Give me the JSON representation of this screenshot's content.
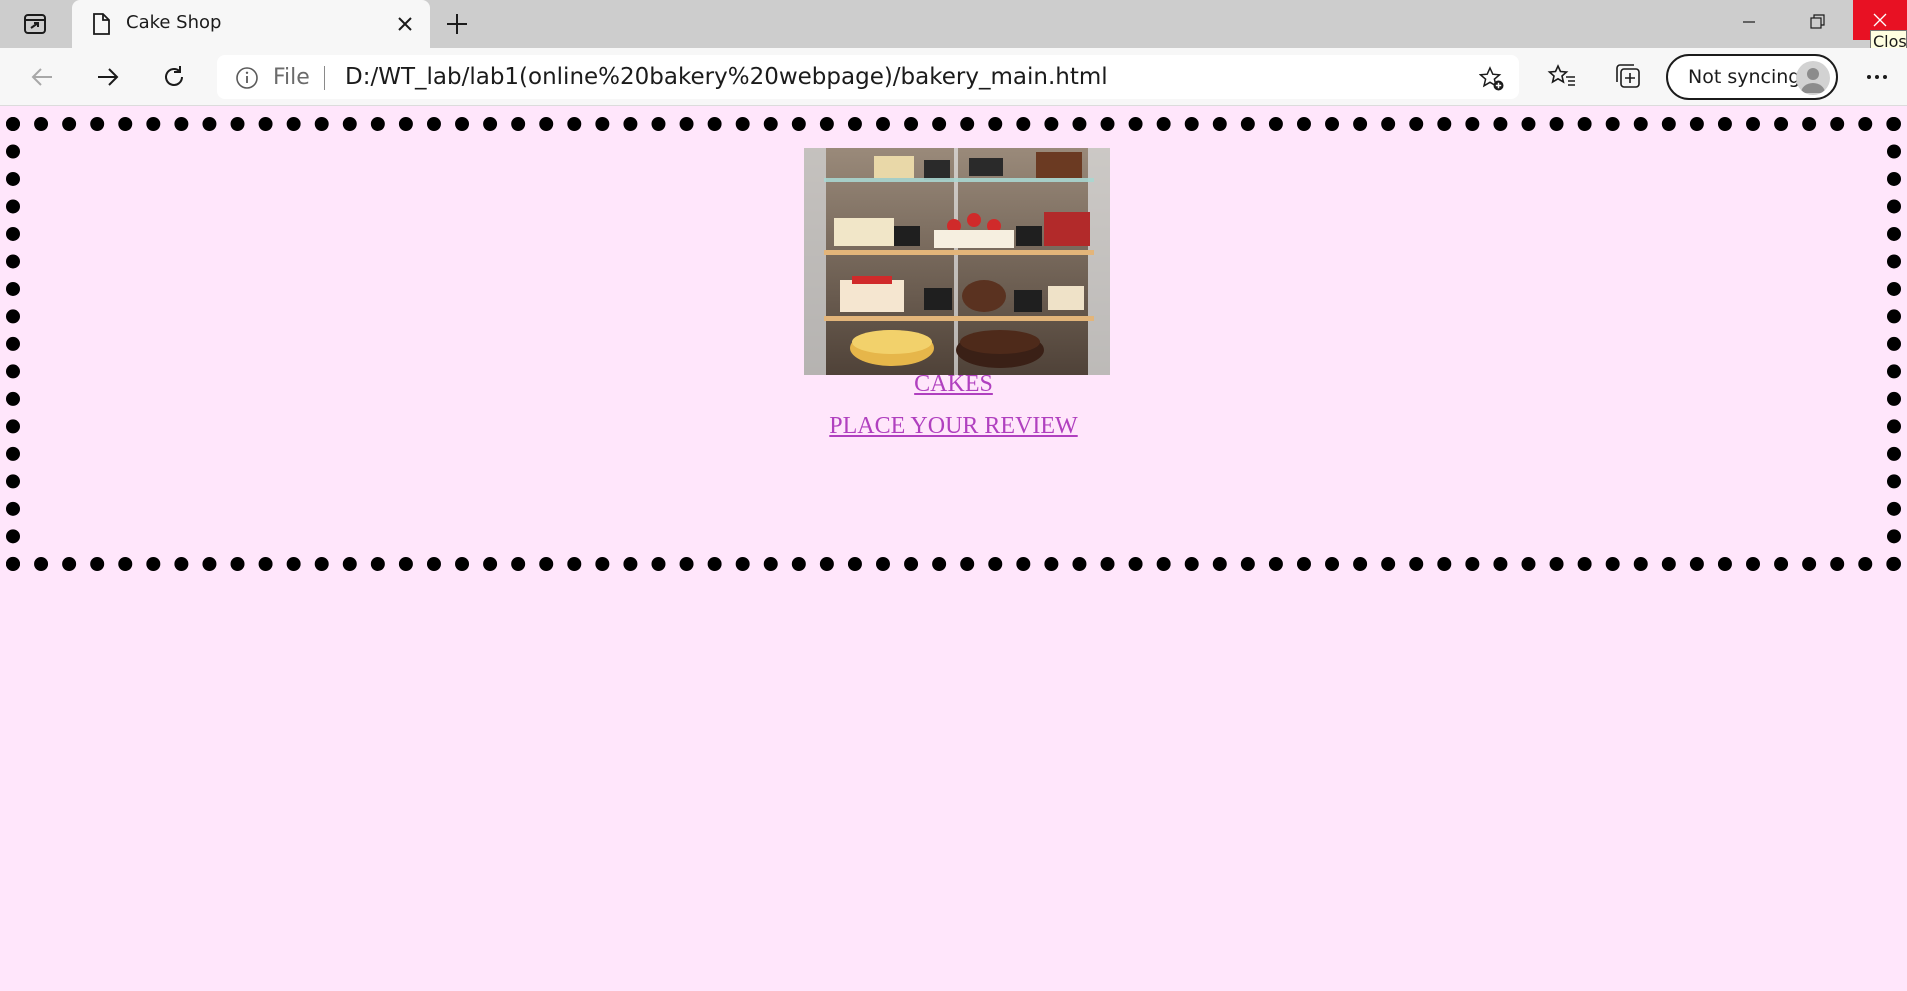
{
  "browser": {
    "tab": {
      "title": "Cake Shop"
    },
    "address_bar": {
      "scheme_label": "File",
      "url": "D:/WT_lab/lab1(online%20bakery%20webpage)/bakery_main.html"
    },
    "profile": {
      "sync_label": "Not syncing"
    },
    "tooltip": "Clos",
    "icons": {
      "tab_actions": "tab-actions-icon",
      "tab_page": "document-icon",
      "tab_close": "close-icon",
      "new_tab": "plus-icon",
      "back": "arrow-left-icon",
      "forward": "arrow-right-icon",
      "refresh": "refresh-icon",
      "site_info": "info-icon",
      "add_favorite": "star-add-icon",
      "favorites": "favorites-icon",
      "collections": "collections-icon",
      "more": "more-icon"
    }
  },
  "page": {
    "background": "#ffe6fb",
    "border_color": "#000000",
    "link_color": "#b040bf",
    "links": [
      {
        "label": "CAKES"
      },
      {
        "label": "PLACE YOUR REVIEW"
      }
    ]
  }
}
